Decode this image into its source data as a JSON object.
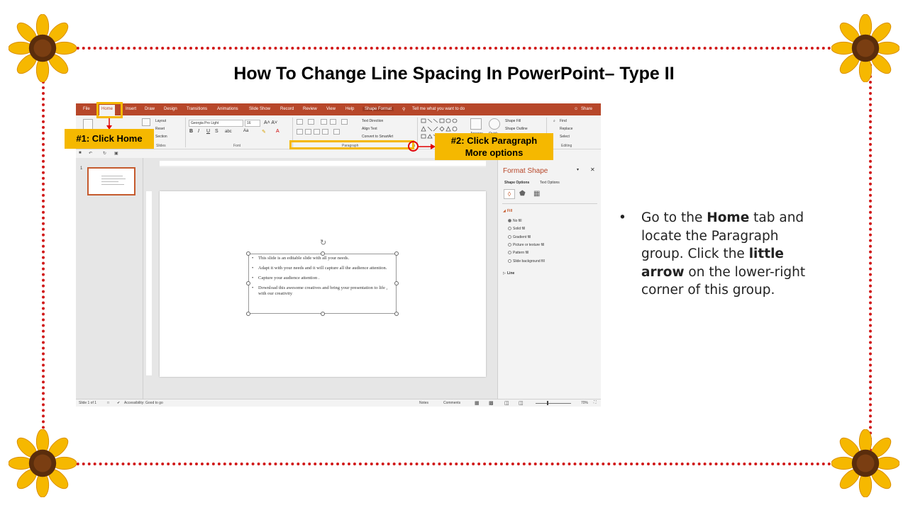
{
  "slide": {
    "title": "How To Change Line Spacing In PowerPoint– Type II",
    "colors": {
      "frame": "#d11919",
      "callout": "#f5b800",
      "ribbon": "#b7472a"
    }
  },
  "ppt": {
    "tabs": [
      "File",
      "Home",
      "Insert",
      "Draw",
      "Design",
      "Transitions",
      "Animations",
      "Slide Show",
      "Record",
      "Review",
      "View",
      "Help",
      "Shape Format"
    ],
    "tell_me": "Tell me what you want to do",
    "share": "Share",
    "ribbon": {
      "layout": "Layout",
      "reset": "Reset",
      "section": "Section",
      "font_name": "Georgia Pro Light",
      "font_size": "16",
      "text_direction": "Text Direction",
      "align_text": "Align Text",
      "convert_smartart": "Convert to SmartArt",
      "shape_fill": "Shape Fill",
      "shape_outline": "Shape Outline",
      "arrange": "Arrange",
      "quick": "Quick",
      "find": "Find",
      "replace": "Replace",
      "select": "Select",
      "groups": {
        "slides": "Slides",
        "font": "Font",
        "paragraph": "Paragraph",
        "editing": "Editing"
      }
    },
    "thumb_number": "1",
    "slide_text": [
      "This slide is an editable slide with all your needs.",
      "Adapt it with your needs and it will capture all the audience attention.",
      "Capture your audience attention .",
      "Download this awesome creatives and bring your presentation to life , with our creativity"
    ],
    "format_pane": {
      "title": "Format Shape",
      "tab_shape": "Shape Options",
      "tab_text": "Text Options",
      "fill_heading": "Fill",
      "fill_options": [
        "No fill",
        "Solid fill",
        "Gradient fill",
        "Picture or texture fill",
        "Pattern fill",
        "Slide background fill"
      ],
      "line_heading": "Line"
    },
    "status": {
      "slide_of": "Slide 1 of 1",
      "accessibility": "Accessibility: Good to go",
      "notes": "Notes",
      "comments": "Comments",
      "zoom": "70%"
    }
  },
  "callouts": {
    "home": "#1: Click Home",
    "paragraph_line1": "#2: Click Paragraph",
    "paragraph_line2": "More options"
  },
  "instructions": {
    "p1": "Go to the ",
    "b1": "Home",
    "p2": " tab and locate the Paragraph group. Click the ",
    "b2": "little arrow",
    "p3": " on the lower-right corner of this group."
  }
}
